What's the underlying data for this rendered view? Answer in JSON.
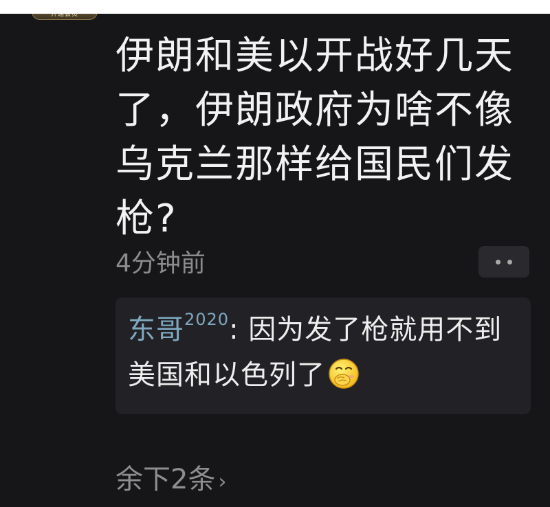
{
  "post": {
    "text": "伊朗和美以开战好几天了，伊朗政府为啥不像乌克兰那样给国民们发枪?",
    "timestamp": "4分钟前"
  },
  "avatar": {
    "badge_text": "开通会员"
  },
  "comment": {
    "author": "东哥",
    "author_suffix": "2020",
    "separator": ": ",
    "text": "因为发了枪就用不到美国和以色列了"
  },
  "replies": {
    "label": "余下2条",
    "chevron": "›"
  },
  "icons": {
    "more": "more-dots-icon",
    "emoji": "covering-mouth-laugh-emoji-icon",
    "chevron": "chevron-right-icon"
  },
  "colors": {
    "background": "#161619",
    "text": "#f2f2f2",
    "muted": "#8c8c8c",
    "author": "#7fa8c0",
    "card": "#222226"
  }
}
